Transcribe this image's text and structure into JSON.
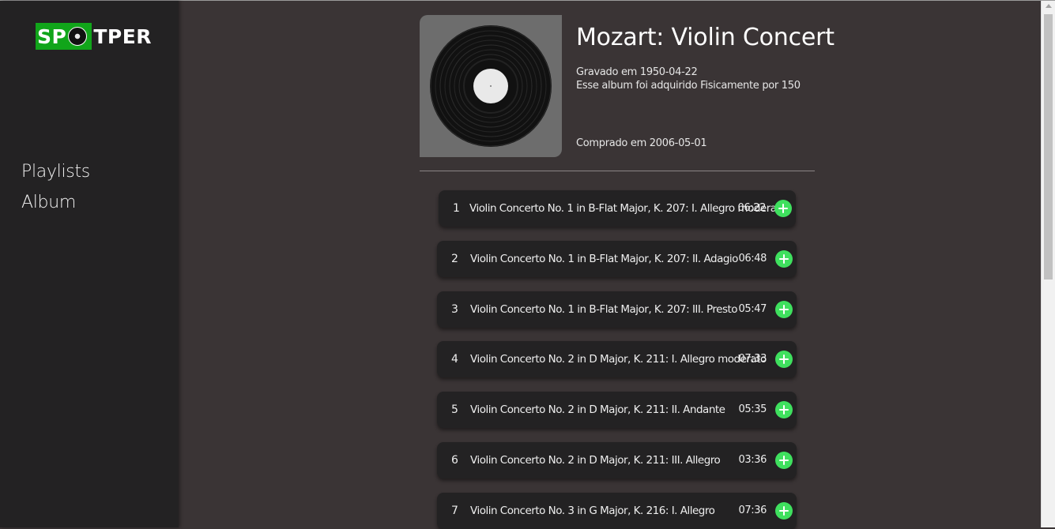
{
  "brand": {
    "logo_prefix": "SP",
    "logo_suffix": "TPER"
  },
  "nav": [
    {
      "label": "Playlists"
    },
    {
      "label": "Album"
    }
  ],
  "album": {
    "title": "Mozart: Violin Concert",
    "recorded": "Gravado em 1950-04-22",
    "acquired": "Esse album foi adquirido Fisicamente por 150",
    "purchased": "Comprado em 2006-05-01"
  },
  "tracks": [
    {
      "num": "1",
      "name": "Violin Concerto No. 1 in B-Flat Major, K. 207: I. Allegro moderato",
      "duration": "06:22"
    },
    {
      "num": "2",
      "name": "Violin Concerto No. 1 in B-Flat Major, K. 207: II. Adagio",
      "duration": "06:48"
    },
    {
      "num": "3",
      "name": "Violin Concerto No. 1 in B-Flat Major, K. 207: III. Presto",
      "duration": "05:47"
    },
    {
      "num": "4",
      "name": "Violin Concerto No. 2 in D Major, K. 211: I. Allegro moderato",
      "duration": "07:33"
    },
    {
      "num": "5",
      "name": "Violin Concerto No. 2 in D Major, K. 211: II. Andante",
      "duration": "05:35"
    },
    {
      "num": "6",
      "name": "Violin Concerto No. 2 in D Major, K. 211: III. Allegro",
      "duration": "03:36"
    },
    {
      "num": "7",
      "name": "Violin Concerto No. 3 in G Major, K. 216: I. Allegro",
      "duration": "07:36"
    }
  ],
  "colors": {
    "accent": "#3fe05e",
    "logo_green": "#11a51a",
    "sidebar": "#232223",
    "background": "#3a3435"
  },
  "icons": {
    "add": "plus-circle-icon",
    "cover": "vinyl-record-icon",
    "logo_disc": "vinyl-disc-icon"
  }
}
